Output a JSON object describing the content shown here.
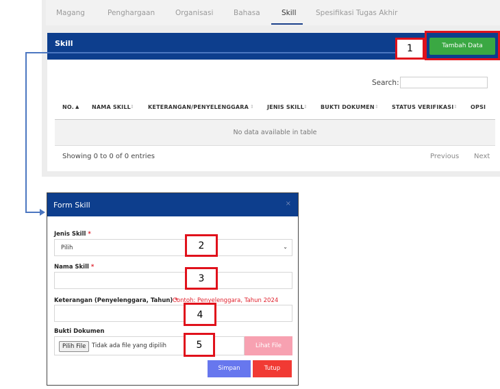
{
  "tabs": [
    "Magang",
    "Penghargaan",
    "Organisasi",
    "Bahasa",
    "Skill",
    "Spesifikasi Tugas Akhir"
  ],
  "active_tab": "Skill",
  "card": {
    "title": "Skill",
    "add_button": "Tambah Data",
    "search_label": "Search:",
    "search_value": "",
    "columns": [
      "NO.",
      "NAMA SKILL",
      "KETERANGAN/PENYELENGGARA",
      "JENIS SKILL",
      "BUKTI DOKUMEN",
      "STATUS VERIFIKASI",
      "OPSI"
    ],
    "empty_text": "No data available in table",
    "info": "Showing 0 to 0 of 0 entries",
    "prev": "Previous",
    "next": "Next"
  },
  "modal": {
    "title": "Form Skill",
    "close_icon": "×",
    "jenis_label": "Jenis Skill",
    "jenis_value": "Pilih",
    "nama_label": "Nama Skill",
    "nama_value": "",
    "ket_label": "Keterangan (Penyelenggara, Tahun)",
    "ket_hint": "Contoh: Penyelenggara, Tahun 2024",
    "ket_value": "",
    "required_mark": "*",
    "bukti_label": "Bukti Dokumen",
    "file_button": "Pilih File",
    "file_text": "Tidak ada file yang dipilih",
    "view_button": "Lihat File",
    "save_button": "Simpan",
    "close_button": "Tutup"
  },
  "annotations": [
    "1",
    "2",
    "3",
    "4",
    "5"
  ],
  "icons": {
    "sort_asc": "▲",
    "sort_both": "⇕",
    "chevron_down": "⌄"
  },
  "colors": {
    "header_blue": "#0d3e8d",
    "add_green": "#3aa843",
    "annotation_red": "#e0111b",
    "connector_blue": "#4b76c0",
    "save_blue": "#6777ee",
    "close_red": "#f13a34",
    "view_pink": "#f7a1b1"
  }
}
